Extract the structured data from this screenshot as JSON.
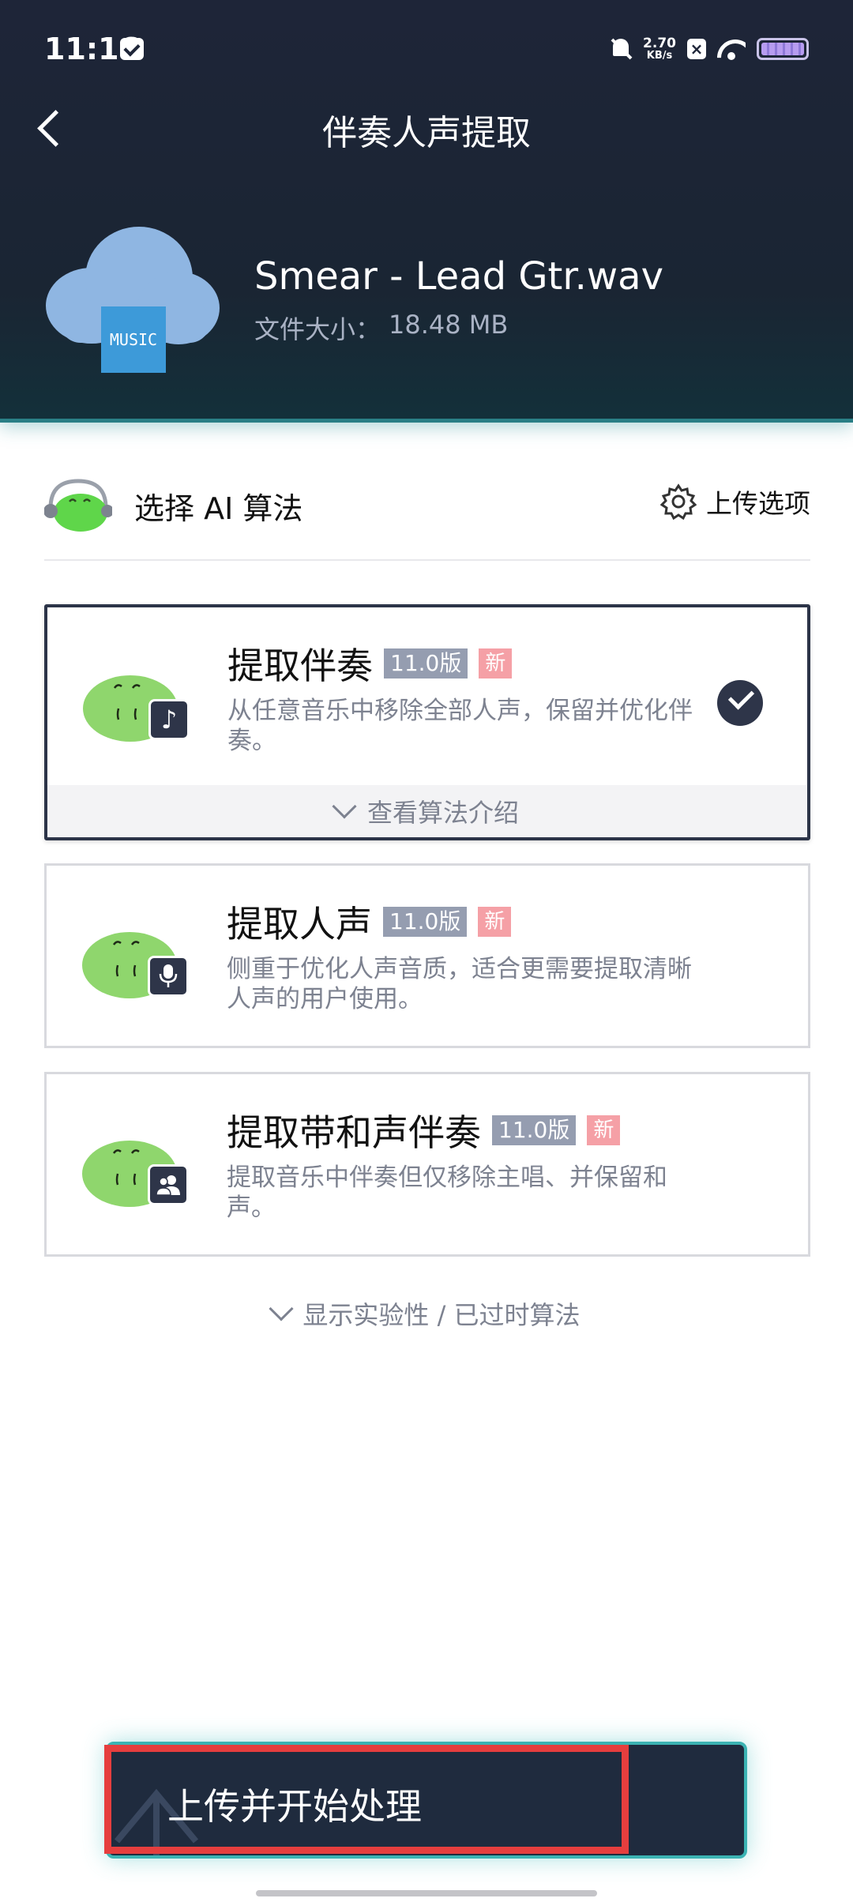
{
  "status_bar": {
    "time": "11:16",
    "net_speed_value": "2.70",
    "net_speed_unit": "KB/s",
    "icons": [
      "mail-icon",
      "bell-off-icon",
      "close-box-icon",
      "wifi-icon",
      "battery-icon"
    ]
  },
  "header": {
    "title": "伴奏人声提取"
  },
  "file": {
    "icon_label": "MUSIC",
    "name": "Smear - Lead Gtr.wav",
    "size_label": "文件大小：",
    "size_value": "18.48 MB"
  },
  "section": {
    "label": "选择 AI 算法",
    "upload_options": "上传选项"
  },
  "algorithms": [
    {
      "title": "提取伴奏",
      "version": "11.0版",
      "new_tag": "新",
      "description": "从任意音乐中移除全部人声，保留并优化伴奏。",
      "badge_icon": "music-note-icon",
      "selected": true,
      "intro_label": "查看算法介绍"
    },
    {
      "title": "提取人声",
      "version": "11.0版",
      "new_tag": "新",
      "description": "侧重于优化人声音质，适合更需要提取清晰人声的用户使用。",
      "badge_icon": "microphone-icon",
      "selected": false
    },
    {
      "title": "提取带和声伴奏",
      "version": "11.0版",
      "new_tag": "新",
      "description": "提取音乐中伴奏但仅移除主唱、并保留和声。",
      "badge_icon": "users-icon",
      "selected": false
    }
  ],
  "show_more": "显示实验性 / 已过时算法",
  "start_button": "上传并开始处理",
  "colors": {
    "header_bg": "#1e2538",
    "accent_teal": "#3bb3b3",
    "dark_navy": "#2e3549",
    "version_tag": "#959db0",
    "new_tag": "#f5a0a6",
    "highlight_red": "#e63e3e",
    "mascot_green": "#6ccb4e"
  }
}
